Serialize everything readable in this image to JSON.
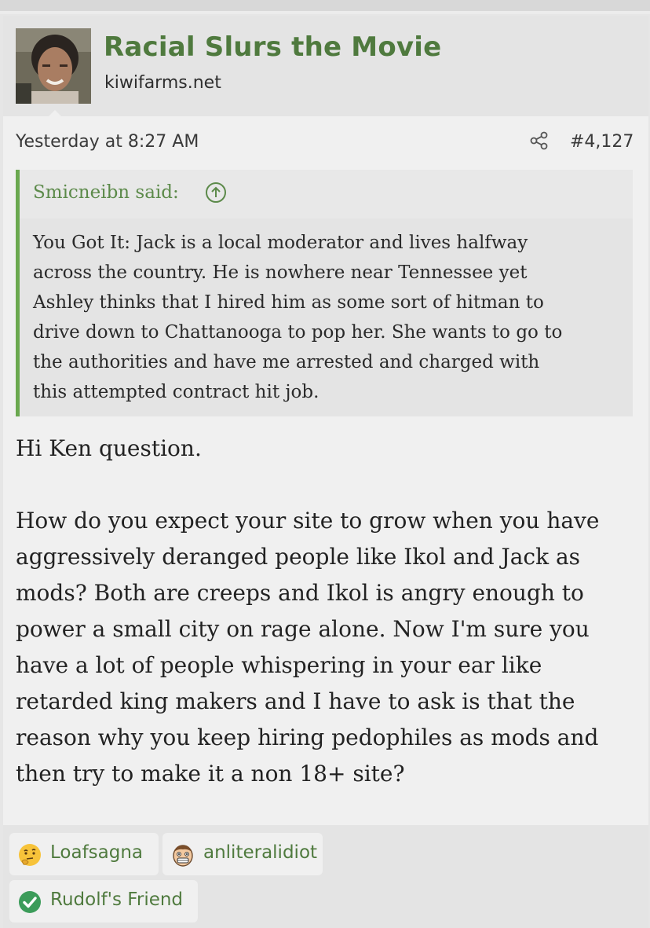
{
  "thread": {
    "username": "Racial Slurs the Movie",
    "user_title": "kiwifarms.net"
  },
  "post": {
    "date": "Yesterday at 8:27 AM",
    "number": "#4,127",
    "share_icon": "share-icon",
    "quote": {
      "author_label": "Smicneibn said:",
      "up_icon": "arrow-up-circle-icon",
      "lines": [
        "You Got It: Jack is a local moderator and lives halfway",
        "across the country. He is nowhere near Tennessee yet",
        "Ashley thinks that I hired him as some sort of hitman to",
        "drive down to Chattanooga to pop her. She wants to go to",
        "the authorities and have me arrested and charged with",
        "this attempted contract hit job."
      ]
    },
    "body": {
      "greeting": "Hi Ken question.",
      "lines": [
        "How do you expect your site to grow when you have",
        "aggressively deranged people like Ikol and Jack as",
        "mods? Both are creeps and Ikol is angry enough to",
        "power a small city on rage alone. Now I'm sure you",
        "have a lot of people whispering in your ear like",
        "retarded king makers and I have to ask is that the",
        "reason why you keep hiring pedophiles as mods and",
        "then try to make it a non 18+ site?"
      ]
    }
  },
  "reactions": [
    {
      "icon": "thinking-face-icon",
      "name": "Loafsagna"
    },
    {
      "icon": "grimacing-face-icon",
      "name": "anliteralidiot"
    },
    {
      "icon": "check-mark-icon",
      "name": "Rudolf's Friend"
    }
  ],
  "colors": {
    "accent_green": "#4f7a3e",
    "quote_border": "#6aa84f"
  }
}
